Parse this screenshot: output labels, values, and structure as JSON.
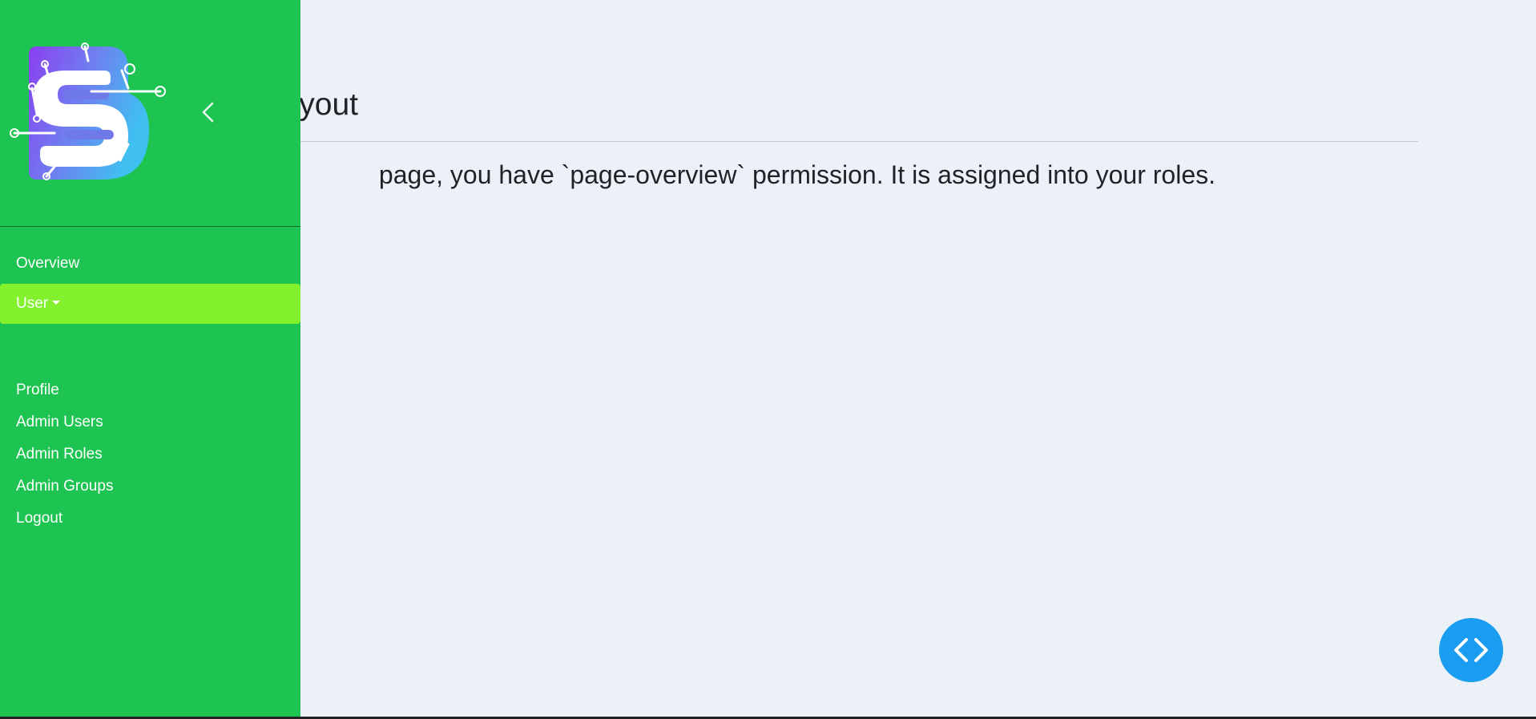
{
  "main": {
    "title": "yout",
    "text": "page, you have `page-overview` permission. It is assigned into your roles."
  },
  "sidebar": {
    "nav": {
      "overview": "Overview",
      "user": "User",
      "profile": "Profile",
      "admin_users": "Admin Users",
      "admin_roles": "Admin Roles",
      "admin_groups": "Admin Groups",
      "logout": "Logout"
    },
    "logo_icon": "brand-s-logo",
    "collapse_icon": "chevron-left-icon"
  },
  "fab": {
    "icon": "code-brackets-icon"
  },
  "colors": {
    "sidebar_bg": "#1dc451",
    "active_item_bg": "#84f12e",
    "content_bg": "#ecf1f8",
    "fab_bg": "#1a9cf0"
  }
}
